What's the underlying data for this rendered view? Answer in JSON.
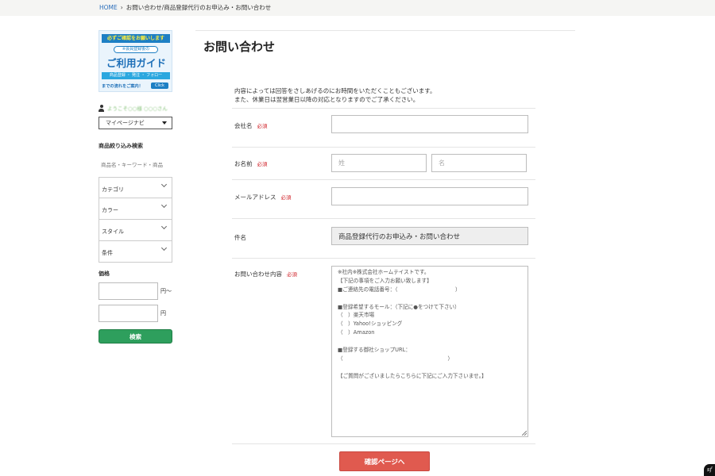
{
  "breadcrumb": {
    "home": "HOME",
    "separator": "›",
    "current": "お問い合わせ/商品登録代行のお申込み・お問い合わせ"
  },
  "sidebar": {
    "banner": {
      "top": "必ずご確認をお願いします",
      "sub": "※会員登録後の",
      "main": "ご利用ガイド",
      "strip": "商品登録 ・ 発注 ・ フォロー",
      "bottom": "までの流れをご案内！",
      "click": "Click"
    },
    "welcome": "ようこそ○○様 ○○○さん",
    "mypage_nav": "マイページナビ",
    "search_title": "商品絞り込み検索",
    "keyword_placeholder": "商品名・キーワード・商品",
    "filters": [
      "カテゴリ",
      "カラー",
      "スタイル",
      "条件"
    ],
    "price_title": "価格",
    "price_from_suffix": "円〜",
    "price_to_suffix": "円",
    "search_button": "検索"
  },
  "main": {
    "title": "お問い合わせ",
    "intro": [
      "内容によっては回答をさしあげるのにお時間をいただくこともございます。",
      "また、休業日は翌営業日以降の対応となりますのでご了承ください。"
    ],
    "required": "必須",
    "fields": {
      "company": {
        "label": "会社名",
        "value": ""
      },
      "name": {
        "label": "お名前",
        "last_placeholder": "姓",
        "first_placeholder": "名"
      },
      "email": {
        "label": "メールアドレス",
        "value": ""
      },
      "subject": {
        "label": "件名",
        "value": "商品登録代行のお申込み・お問い合わせ"
      },
      "inquiry": {
        "label": "お問い合わせ内容",
        "lines": [
          "※社内※株式会社ホームテイストです。",
          "【下記の事項をご入力お願い致します】",
          "■ご連絡先の電話番号：（　　　　　　　　　　　）",
          "",
          "■登録希望するモール：（下記に●をつけて下さい）",
          "（　）楽天市場",
          "（　）Yahoo!ショッピング",
          "（　）Amazon",
          "",
          "■登録する御社ショップURL：",
          "（　　　　　　　　　　　　　　　　　　　　）",
          "",
          "【ご質問がございましたらこちらに下記にご入力下さいませ。】"
        ]
      }
    },
    "confirm_button": "確認ページへ"
  },
  "colors": {
    "link": "#2a6ebb",
    "required": "#d0232a",
    "search_button": "#2e9f5d",
    "confirm_button": "#e05a4f"
  }
}
